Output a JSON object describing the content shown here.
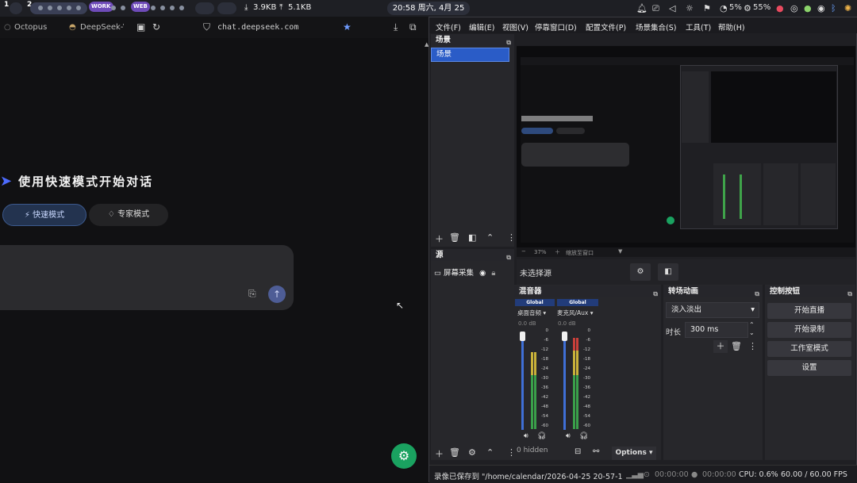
{
  "topbar": {
    "ws1": "1",
    "ws2": "2",
    "badge_work": "WORK",
    "badge_web": "WEB",
    "net_down": "3.9KB",
    "net_up": "5.1KB",
    "clock": "20:58 周六, 4月 25",
    "cpu": "5%",
    "mem": "55%"
  },
  "browser": {
    "tabs": [
      "Octopus",
      "DeepSeek-V"
    ],
    "url": "chat.deepseek.com",
    "welcome": "使用快速模式开始对话",
    "mode_fast": "快速模式",
    "mode_expert": "专家模式"
  },
  "obs": {
    "menu": [
      "文件(F)",
      "编辑(E)",
      "视图(V)",
      "停靠窗口(D)",
      "配置文件(P)",
      "场景集合(S)",
      "工具(T)",
      "帮助(H)"
    ],
    "scenes_title": "场景",
    "scene_item": "场景",
    "sources_title": "源",
    "source_item": "屏幕采集",
    "no_source": "未选择源",
    "zoom": "37%",
    "zoom_mode": "缩放至窗口",
    "mixer_title": "混音器",
    "mixer": {
      "channels": [
        {
          "global": "Global",
          "label": "桌面音频",
          "db": "0.0 dB",
          "level": 0.78
        },
        {
          "global": "Global",
          "label": "麦克风/Aux",
          "db": "0.0 dB",
          "level": 0.93
        }
      ],
      "ticks": [
        "0",
        "-6",
        "-12",
        "-18",
        "-24",
        "-30",
        "-36",
        "-42",
        "-48",
        "-54",
        "-60"
      ],
      "hidden": "0 hidden",
      "options": "Options"
    },
    "trans_title": "转场动画",
    "transition": "淡入淡出",
    "duration_label": "时长",
    "duration": "300 ms",
    "controls_title": "控制按钮",
    "controls": [
      "开始直播",
      "开始录制",
      "工作室模式",
      "设置"
    ],
    "status": {
      "saved": "录像已保存到 \"/home/calendar/2026-04-25 20-57-17.m",
      "stream_time": "00:00:00",
      "rec_time": "00:00:00",
      "cpu": "CPU: 0.6%",
      "fps": "60.00 / 60.00 FPS"
    }
  }
}
